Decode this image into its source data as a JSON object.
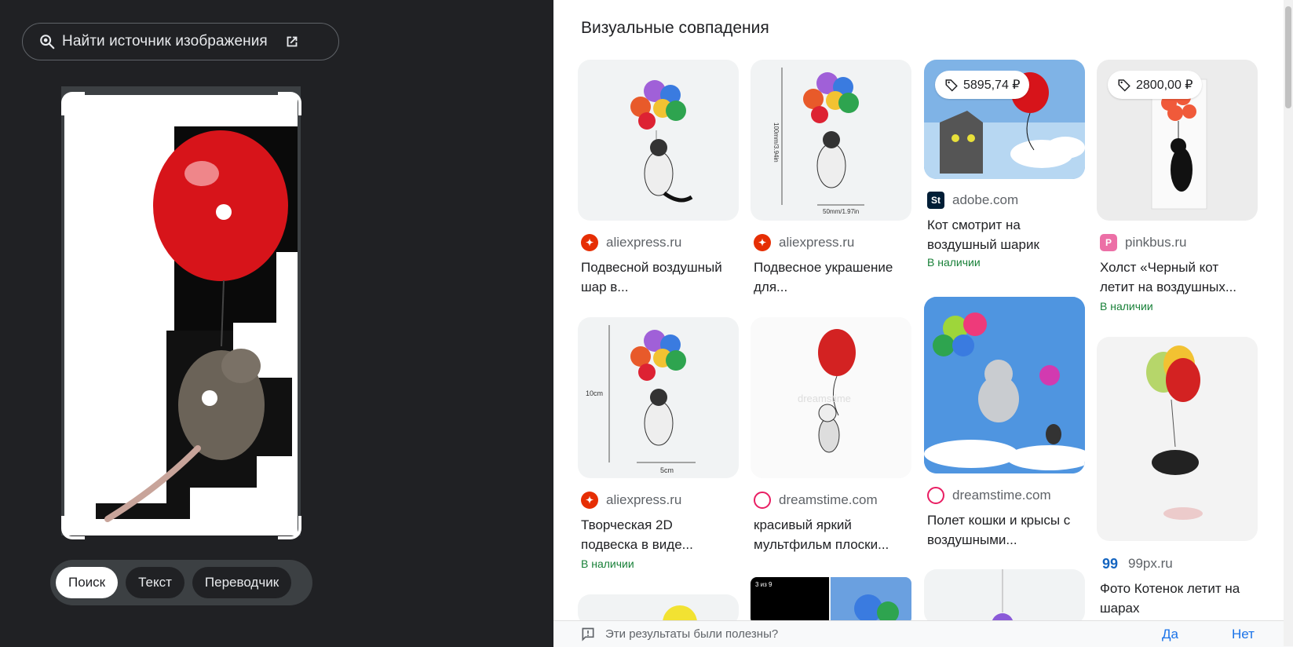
{
  "left": {
    "find_source_label": "Найти источник изображения",
    "modes": [
      {
        "label": "Поиск",
        "active": true
      },
      {
        "label": "Текст",
        "active": false
      },
      {
        "label": "Переводчик",
        "active": false
      }
    ]
  },
  "results": {
    "section_title": "Визуальные совпадения",
    "cards": [
      {
        "source": "aliexpress.ru",
        "favicon": "aliexpress-icon",
        "title": "Подвесной воздушный шар в...",
        "in_stock": ""
      },
      {
        "source": "aliexpress.ru",
        "favicon": "aliexpress-icon",
        "title": "Подвесное украшение для...",
        "in_stock": ""
      },
      {
        "source": "adobe.com",
        "favicon": "adobe-stock-icon",
        "favicon_text": "St",
        "title": "Кот смотрит на воздушный шарик",
        "in_stock": "В наличии",
        "price": "5895,74 ₽"
      },
      {
        "source": "pinkbus.ru",
        "favicon": "pinkbus-icon",
        "favicon_text": "P",
        "title": "Холст «Черный кот летит на воздушных...",
        "in_stock": "В наличии",
        "price": "2800,00 ₽"
      },
      {
        "source": "aliexpress.ru",
        "favicon": "aliexpress-icon",
        "title": "Творческая 2D подвеска в виде...",
        "in_stock": "В наличии"
      },
      {
        "source": "dreamstime.com",
        "favicon": "dreamstime-icon",
        "title": "красивый яркий мультфильм плоски...",
        "in_stock": ""
      },
      {
        "source": "dreamstime.com",
        "favicon": "dreamstime-icon",
        "title": "Полет кошки и крысы с воздушными...",
        "in_stock": ""
      },
      {
        "source": "99px.ru",
        "favicon": "99px-icon",
        "favicon_text": "99",
        "title": "Фото Котенок летит на шарах",
        "in_stock": ""
      }
    ]
  },
  "thumb_text": {
    "size_label_a": "100mm/3.94in",
    "size_label_b": "50mm/1.97in",
    "size_label_c": "10cm",
    "size_label_d": "5cm",
    "watermark": "dreamstime",
    "counter": "3 из 9"
  },
  "feedback": {
    "question": "Эти результаты были полезны?",
    "yes": "Да",
    "no": "Нет"
  },
  "colors": {
    "aliexpress": "#e62e04",
    "dreamstime": "#e91e63",
    "adobe": "#001e36",
    "pinkbus": "#ec6fa6",
    "in_stock": "#188038"
  }
}
